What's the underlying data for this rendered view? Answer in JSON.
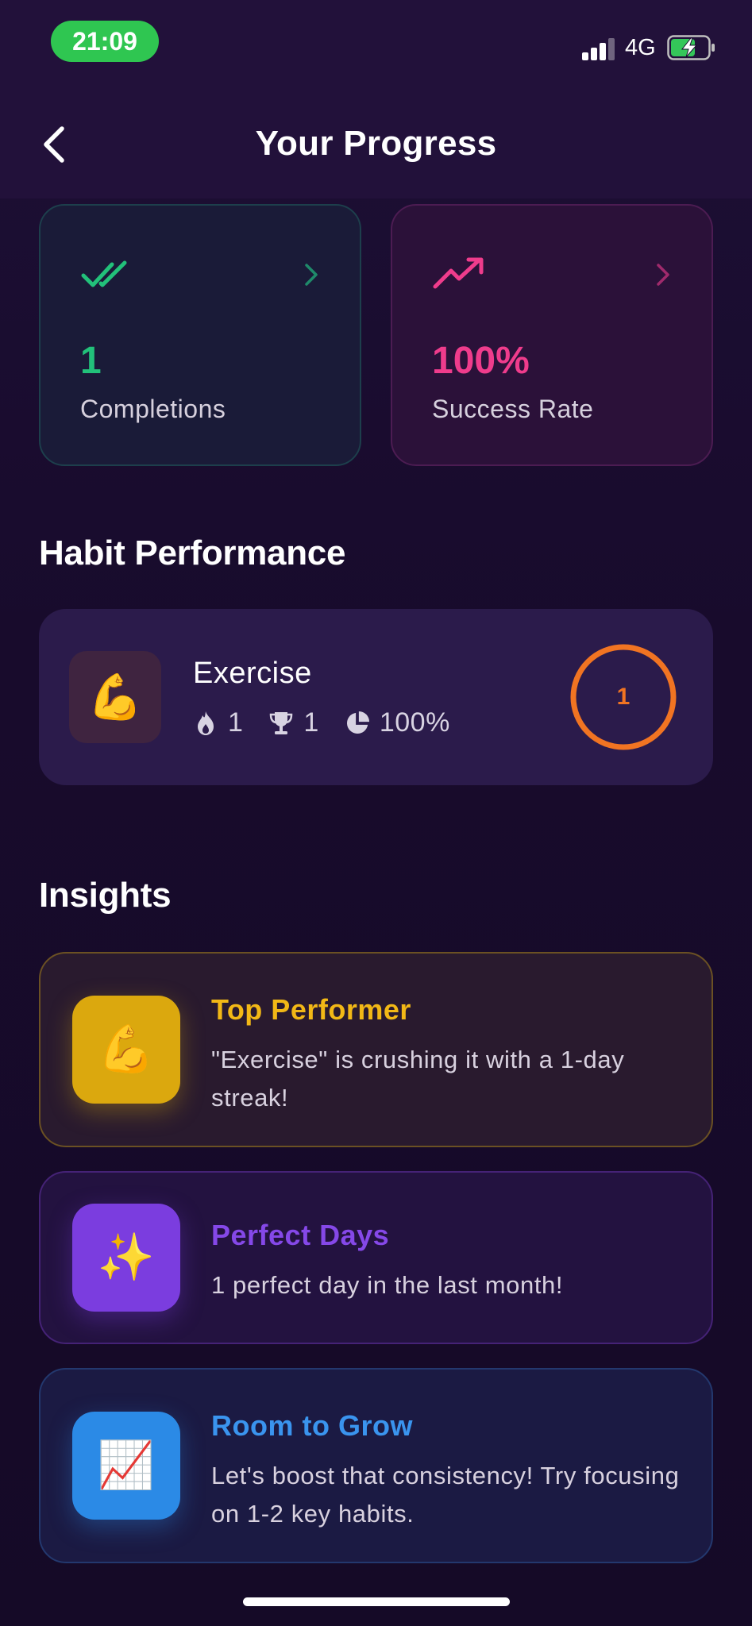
{
  "status_bar": {
    "time": "21:09",
    "network": "4G"
  },
  "header": {
    "title": "Your Progress"
  },
  "stats": [
    {
      "value": "1",
      "label": "Completions",
      "icon": "double-check-icon",
      "color": "#22c17a"
    },
    {
      "value": "100%",
      "label": "Success Rate",
      "icon": "trending-up-icon",
      "color": "#ef3c8c"
    }
  ],
  "habit_section": {
    "title": "Habit Performance",
    "habits": [
      {
        "emoji": "💪",
        "name": "Exercise",
        "streak": "1",
        "best": "1",
        "rate": "100%",
        "ring_value": "1",
        "ring_color": "#f17422"
      }
    ]
  },
  "insights_section": {
    "title": "Insights",
    "items": [
      {
        "emoji": "💪",
        "title": "Top Performer",
        "text": "\"Exercise\" is crushing it with a 1-day streak!",
        "color": "#f2b816"
      },
      {
        "emoji": "✨",
        "title": "Perfect Days",
        "text": "1 perfect day in the last month!",
        "color": "#8548e8"
      },
      {
        "emoji": "📈",
        "title": "Room to Grow",
        "text": "Let's boost that consistency! Try focusing on 1-2 key habits.",
        "color": "#3a94ee"
      }
    ]
  }
}
